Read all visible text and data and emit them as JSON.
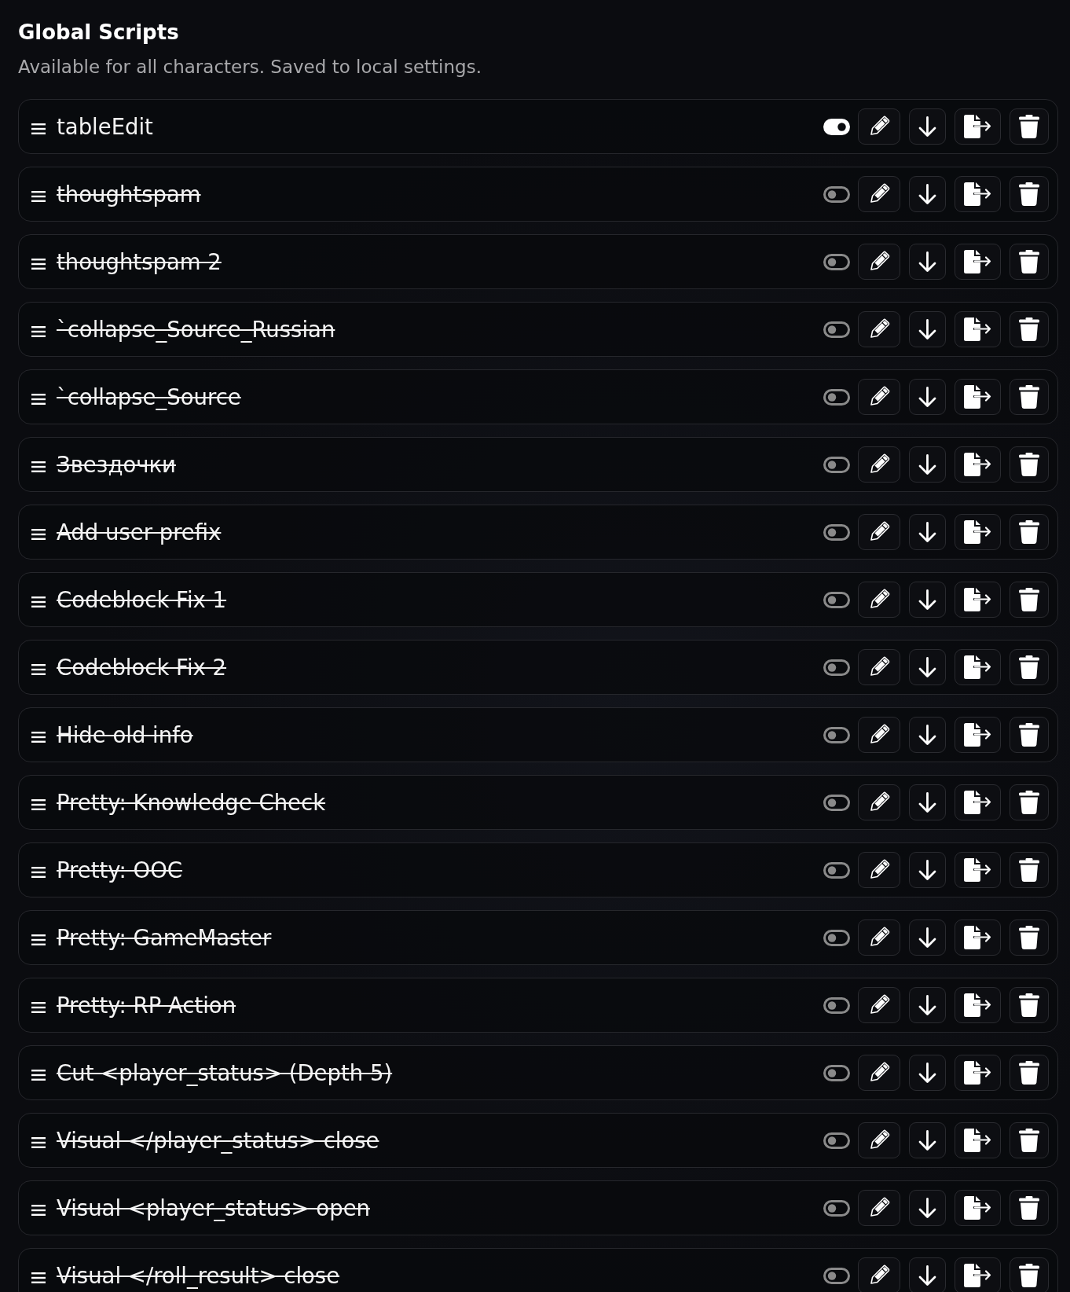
{
  "header": {
    "title": "Global Scripts",
    "subtitle": "Available for all characters. Saved to local settings."
  },
  "scripts": [
    {
      "name": "tableEdit",
      "enabled": true
    },
    {
      "name": "thoughtspam",
      "enabled": false
    },
    {
      "name": "thoughtspam 2",
      "enabled": false
    },
    {
      "name": "`collapse_Source_Russian",
      "enabled": false
    },
    {
      "name": "`collapse_Source",
      "enabled": false
    },
    {
      "name": "Звездочки",
      "enabled": false
    },
    {
      "name": "Add user prefix",
      "enabled": false
    },
    {
      "name": "Codeblock Fix 1",
      "enabled": false
    },
    {
      "name": "Codeblock Fix 2",
      "enabled": false
    },
    {
      "name": "Hide old info",
      "enabled": false
    },
    {
      "name": "Pretty: Knowledge Check",
      "enabled": false
    },
    {
      "name": "Pretty: OOC",
      "enabled": false
    },
    {
      "name": "Pretty: GameMaster",
      "enabled": false
    },
    {
      "name": "Pretty: RP Action",
      "enabled": false
    },
    {
      "name": "Cut <player_status> (Depth 5)",
      "enabled": false
    },
    {
      "name": "Visual </player_status> close",
      "enabled": false
    },
    {
      "name": "Visual <player_status> open",
      "enabled": false
    },
    {
      "name": "Visual </roll_result> close",
      "enabled": false
    }
  ]
}
